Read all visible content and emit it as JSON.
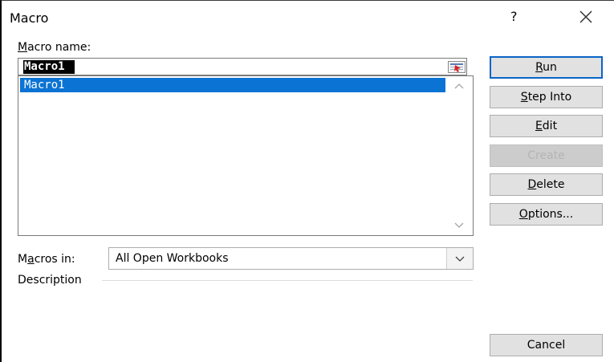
{
  "window": {
    "title": "Macro",
    "help_glyph": "?",
    "close_glyph": "✕"
  },
  "macro_name": {
    "label_access": "M",
    "label_rest": "acro name:",
    "value": "Macro1"
  },
  "macro_list": {
    "items": [
      "Macro1"
    ],
    "selected_index": 0
  },
  "macros_in": {
    "label_pre": "M",
    "label_access": "a",
    "label_rest": "cros in:",
    "selected": "All Open Workbooks"
  },
  "description": {
    "label": "Description"
  },
  "buttons": {
    "run": {
      "access": "R",
      "rest": "un"
    },
    "step_into": {
      "access": "S",
      "rest": "tep Into"
    },
    "edit": {
      "access": "E",
      "rest": "dit"
    },
    "create": {
      "label": "Create",
      "enabled": false
    },
    "delete": {
      "access": "D",
      "rest": "elete"
    },
    "options": {
      "access": "O",
      "rest": "ptions..."
    },
    "cancel": {
      "label": "Cancel"
    }
  },
  "colors": {
    "selection": "#0b73d3",
    "default_button_border": "#0a64c8",
    "button_face": "#e1e1e1"
  }
}
